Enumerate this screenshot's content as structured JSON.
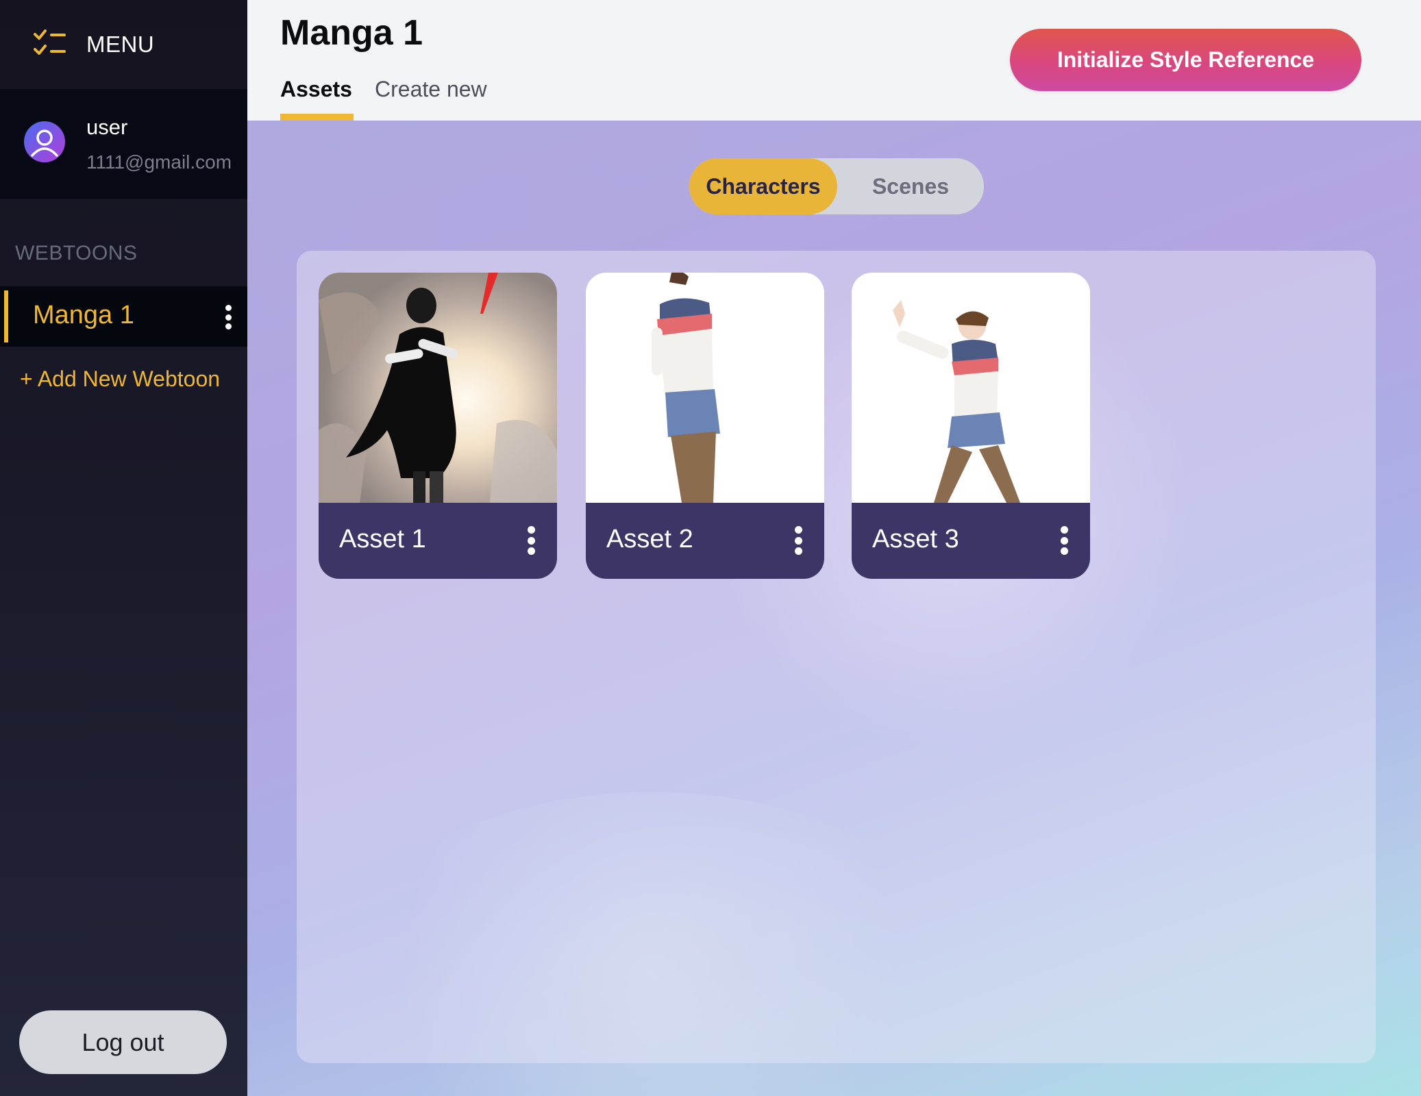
{
  "sidebar": {
    "menu_label": "MENU",
    "menu_icon": "checklist-icon",
    "user": {
      "name": "user",
      "email": "1111@gmail.com",
      "avatar_icon": "user-avatar-icon"
    },
    "section_label": "WEBTOONS",
    "webtoons": [
      {
        "label": "Manga 1",
        "selected": true
      }
    ],
    "add_label": "+ Add New Webtoon",
    "logout_label": "Log out"
  },
  "header": {
    "title": "Manga 1",
    "tabs": [
      {
        "label": "Assets",
        "active": true
      },
      {
        "label": "Create new",
        "active": false
      }
    ],
    "init_button_label": "Initialize Style Reference"
  },
  "main": {
    "toggle": [
      {
        "label": "Characters",
        "active": true
      },
      {
        "label": "Scenes",
        "active": false
      }
    ],
    "assets": [
      {
        "name": "Asset 1"
      },
      {
        "name": "Asset 2"
      },
      {
        "name": "Asset 3"
      }
    ]
  },
  "colors": {
    "accent": "#f0b72f",
    "sidebar_bg": "#1a1929",
    "card_footer": "#3d3566",
    "primary_button": "#d9477e"
  }
}
